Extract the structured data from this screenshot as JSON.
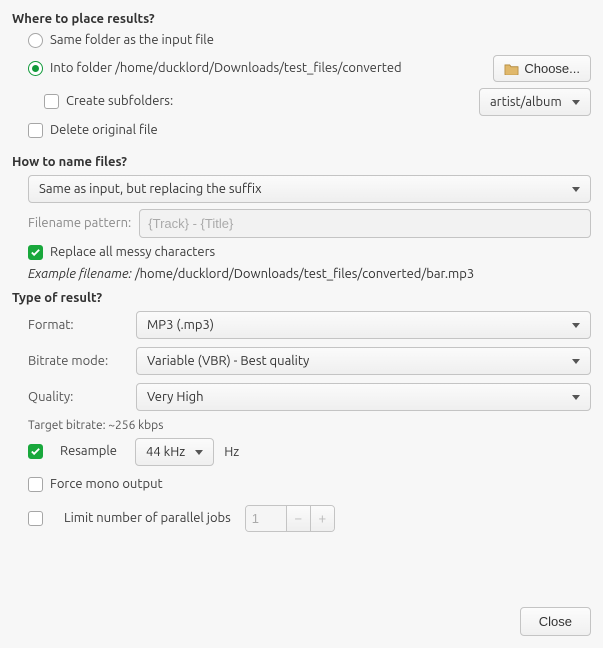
{
  "place": {
    "title": "Where to place results?",
    "same_folder": "Same folder as the input file",
    "into_folder_prefix": "Into folder",
    "into_folder_path": "/home/ducklord/Downloads/test_files/converted",
    "choose": "Choose...",
    "create_subfolders": "Create subfolders:",
    "subfolder_pattern": "artist/album",
    "delete_original": "Delete original file"
  },
  "naming": {
    "title": "How to name files?",
    "mode": "Same as input, but replacing the suffix",
    "pattern_label": "Filename pattern:",
    "pattern_placeholder": "{Track} - {Title}",
    "replace_messy": "Replace all messy characters",
    "example_label": "Example filename:",
    "example_value": "/home/ducklord/Downloads/test_files/converted/bar.mp3"
  },
  "result": {
    "title": "Type of result?",
    "format_label": "Format:",
    "format_value": "MP3 (.mp3)",
    "bitrate_label": "Bitrate mode:",
    "bitrate_value": "Variable (VBR) - Best quality",
    "quality_label": "Quality:",
    "quality_value": "Very High",
    "target_bitrate": "Target bitrate: ~256 kbps",
    "resample_label": "Resample",
    "resample_value": "44 kHz",
    "resample_unit": "Hz",
    "force_mono": "Force mono output",
    "limit_jobs": "Limit number of parallel jobs",
    "jobs_value": "1"
  },
  "footer": {
    "close": "Close"
  }
}
